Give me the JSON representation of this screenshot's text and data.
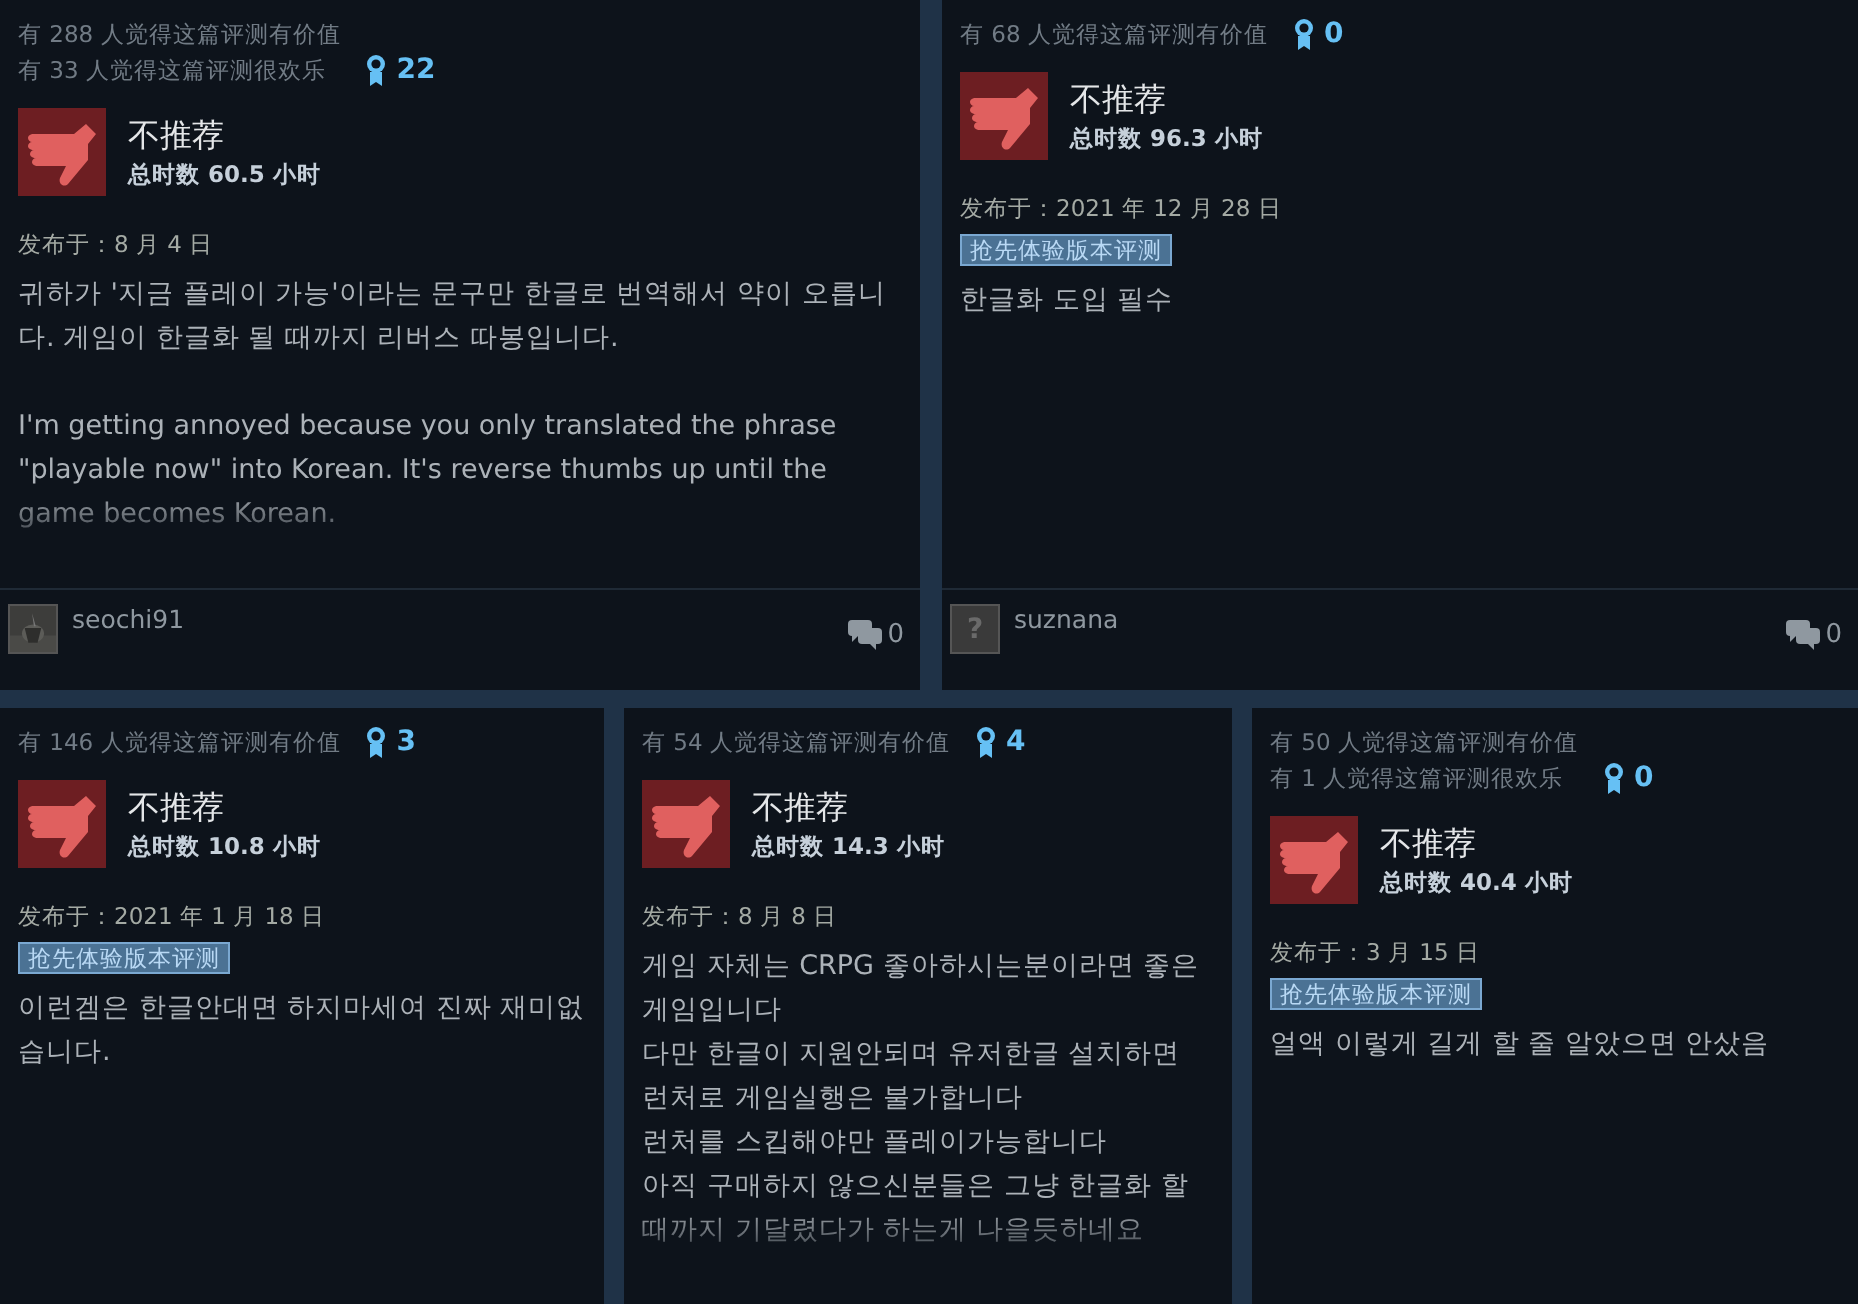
{
  "rows": [
    [
      {
        "helpful_lines": [
          "有 288 人觉得这篇评测有价值",
          "有 33 人觉得这篇评测很欢乐"
        ],
        "awards": "22",
        "verdict": "不推荐",
        "recommended": false,
        "hours": "总时数 60.5 小时",
        "posted": "发布于：8 月 4 日",
        "paragraphs": [
          "귀하가 '지금 플레이 가능'이라는 문구만 한글로 번역해서 약이 오릅니다. 게임이 한글화 될 때까지 리버스 따봉입니다.",
          "I'm getting annoyed because you only translated the phrase \"playable now\" into Korean. It's reverse thumbs up until the game becomes Korean."
        ],
        "truncated": true,
        "author": {
          "name": "seochi91"
        },
        "comments": "0"
      },
      {
        "helpful_lines": [
          "有 68 人觉得这篇评测有价值"
        ],
        "awards": "0",
        "verdict": "不推荐",
        "recommended": false,
        "hours": "总时数 96.3 小时",
        "posted": "发布于：2021 年 12 月 28 日",
        "tag": "抢先体验版本评测",
        "paragraphs": [
          "한글화 도입 필수"
        ],
        "truncated": false,
        "author": {
          "name": "suznana",
          "avatar": {
            "kind": "placeholder",
            "glyph": "?"
          }
        },
        "comments": "0"
      }
    ],
    [
      {
        "helpful_lines": [
          "有 146 人觉得这篇评测有价值"
        ],
        "awards": "3",
        "verdict": "不推荐",
        "recommended": false,
        "hours": "总时数 10.8 小时",
        "posted": "发布于：2021 年 1 月 18 日",
        "tag": "抢先体验版本评测",
        "paragraphs": [
          "이런겜은 한글안대면 하지마세여 진짜 재미없습니다."
        ],
        "truncated": false
      },
      {
        "helpful_lines": [
          "有 54 人觉得这篇评测有价值"
        ],
        "awards": "4",
        "verdict": "不推荐",
        "recommended": false,
        "hours": "总时数 14.3 小时",
        "posted": "发布于：8 月 8 日",
        "paragraphs": [
          "게임 자체는 CRPG 좋아하시는분이라면 좋은 게임입니다\n다만 한글이 지원안되며 유저한글 설치하면\n런처로 게임실행은 불가합니다\n런처를 스킵해야만 플레이가능합니다\n아직 구매하지 않으신분들은 그냥 한글화 할 때까지 기달렸다가 하는게 나을듯하네요"
        ],
        "truncated": true
      },
      {
        "helpful_lines": [
          "有 50 人觉得这篇评测有价值",
          "有 1 人觉得这篇评测很欢乐"
        ],
        "awards": "0",
        "verdict": "不推荐",
        "recommended": false,
        "hours": "总时数 40.4 小时",
        "posted": "发布于：3 月 15 日",
        "tag": "抢先体验版本评测",
        "paragraphs": [
          "얼액 이렇게 길게 할 줄 알았으면 안샀음"
        ],
        "truncated": false
      }
    ]
  ]
}
